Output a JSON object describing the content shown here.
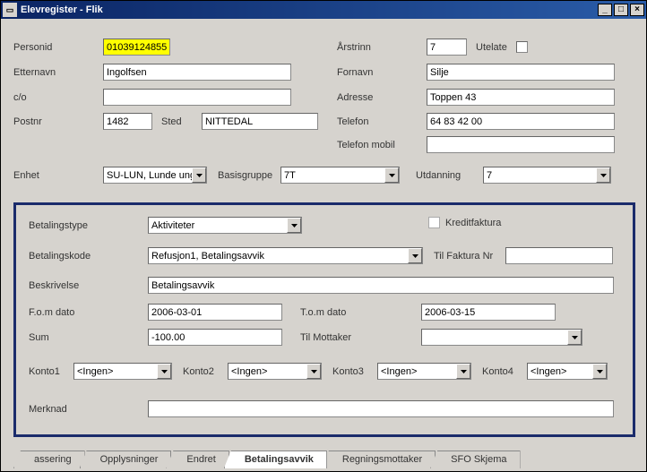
{
  "window": {
    "title": "Elevregister - Flik"
  },
  "top": {
    "personid_label": "Personid",
    "personid": "01039124855",
    "arstrinn_label": "Årstrinn",
    "arstrinn": "7",
    "utelate_label": "Utelate",
    "etternavn_label": "Etternavn",
    "etternavn": "Ingolfsen",
    "fornavn_label": "Fornavn",
    "fornavn": "Silje",
    "co_label": "c/o",
    "co": "",
    "adresse_label": "Adresse",
    "adresse": "Toppen 43",
    "postnr_label": "Postnr",
    "postnr": "1482",
    "sted_label": "Sted",
    "sted": "NITTEDAL",
    "telefon_label": "Telefon",
    "telefon": "64 83 42 00",
    "telefonmobil_label": "Telefon mobil",
    "telefonmobil": "",
    "enhet_label": "Enhet",
    "enhet": "SU-LUN, Lunde ung",
    "basisgruppe_label": "Basisgruppe",
    "basisgruppe": "7T",
    "utdanning_label": "Utdanning",
    "utdanning": "7"
  },
  "panel": {
    "betalingstype_label": "Betalingstype",
    "betalingstype": "Aktiviteter",
    "kreditfaktura_label": "Kreditfaktura",
    "betalingskode_label": "Betalingskode",
    "betalingskode": "Refusjon1, Betalingsavvik",
    "tilfakturanr_label": "Til Faktura Nr",
    "tilfakturanr": "",
    "beskrivelse_label": "Beskrivelse",
    "beskrivelse": "Betalingsavvik",
    "fomdato_label": "F.o.m dato",
    "fomdato": "2006-03-01",
    "tomdato_label": "T.o.m dato",
    "tomdato": "2006-03-15",
    "sum_label": "Sum",
    "sum": "-100.00",
    "tilmottaker_label": "Til Mottaker",
    "tilmottaker": "",
    "konto1_label": "Konto1",
    "konto1": "<Ingen>",
    "konto2_label": "Konto2",
    "konto2": "<Ingen>",
    "konto3_label": "Konto3",
    "konto3": "<Ingen>",
    "konto4_label": "Konto4",
    "konto4": "<Ingen>",
    "merknad_label": "Merknad",
    "merknad": ""
  },
  "tabs": {
    "t1": "assering",
    "t2": "Opplysninger",
    "t3": "Endret",
    "t4": "Betalingsavvik",
    "t5": "Regningsmottaker",
    "t6": "SFO Skjema"
  }
}
